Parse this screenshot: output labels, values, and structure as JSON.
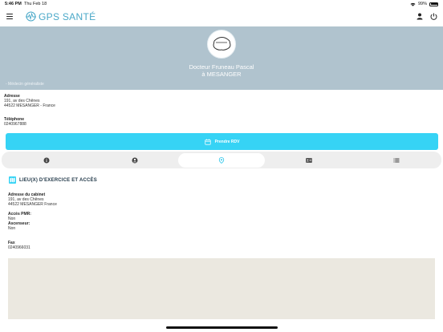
{
  "status_bar": {
    "time": "5:46 PM",
    "date": "Thu Feb 18",
    "battery": "99%"
  },
  "app": {
    "logo_text": "GPS SANTÉ",
    "icons": {
      "menu": "menu-icon",
      "user": "user-icon",
      "power": "power-icon"
    }
  },
  "profile": {
    "name": "Docteur Fruneau Pascal",
    "city": "à MESANGER",
    "specialty": "- Médecin généraliste"
  },
  "contact": {
    "address_label": "Adresse",
    "address_line1": "191, av des Chênes",
    "address_line2": "44522 MESANGER - France",
    "phone_label": "Téléphone",
    "phone": "0240967888"
  },
  "rdv_button": {
    "label": "Prendre RDV"
  },
  "tabs": [
    {
      "icon": "info-icon",
      "active": false
    },
    {
      "icon": "person-icon",
      "active": false
    },
    {
      "icon": "location-pin-icon",
      "active": true
    },
    {
      "icon": "id-card-icon",
      "active": false
    },
    {
      "icon": "list-icon",
      "active": false
    }
  ],
  "section": {
    "title": "LIEU(X) D'EXERCICE ET ACCÈS",
    "cabinet_label": "Adresse du cabinet",
    "cabinet_line1": "191, av des Chênes",
    "cabinet_line2": "44522 MESANGER France",
    "pmr_label": "Accès PMR:",
    "pmr_value": "Non",
    "elevator_label": "Ascenseur:",
    "elevator_value": "Non",
    "fax_label": "Fax",
    "fax_value": "0240966031"
  },
  "colors": {
    "accent": "#36d3f5",
    "header_bg": "#b0c3ce",
    "logo": "#4aa8c8"
  }
}
